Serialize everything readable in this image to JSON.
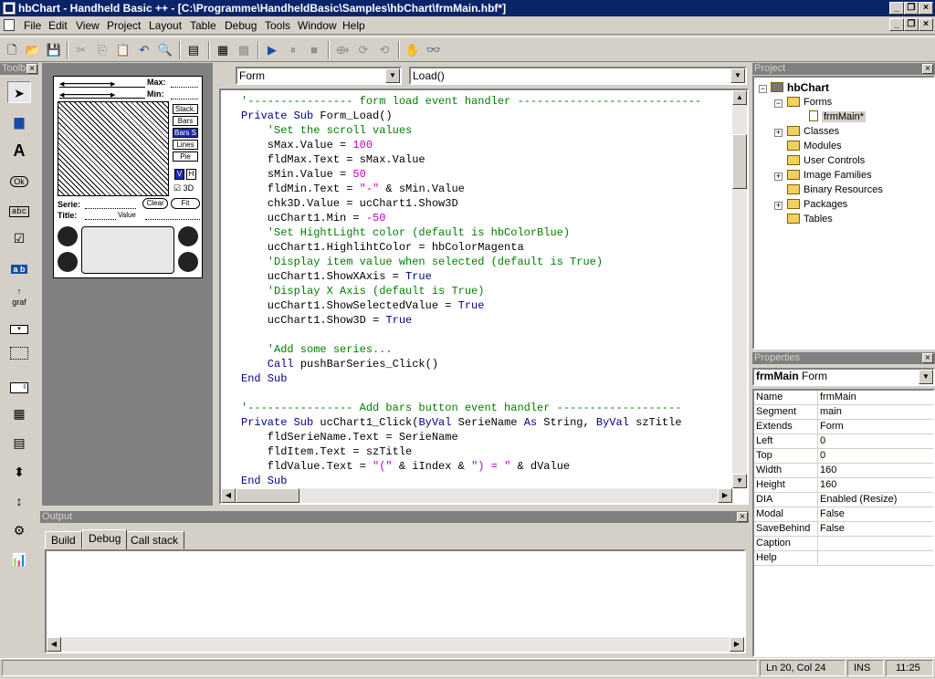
{
  "window": {
    "title": "hbChart - Handheld Basic ++ - [C:\\Programme\\HandheldBasic\\Samples\\hbChart\\frmMain.hbf*]"
  },
  "menu": [
    "File",
    "Edit",
    "View",
    "Project",
    "Layout",
    "Table",
    "Debug",
    "Tools",
    "Window",
    "Help"
  ],
  "toolbox": {
    "title": "Toolb"
  },
  "toolbox_items": [
    "pointer-tool",
    "image-tool",
    "label-tool",
    "button-tool",
    "field-tool",
    "checkbox-tool",
    "pushbutton-tool",
    "graffiti-tool",
    "popup-tool",
    "selector-tool",
    "scroll-tool",
    "table-tool",
    "list-tool",
    "slider-tool",
    "repeat-tool",
    "gadget-tool",
    "chart-tool"
  ],
  "toolbox_labels": {
    "ok": "Ok",
    "abc": "abc",
    "ab": "a b",
    "graf": "graf"
  },
  "form": {
    "max_label": "Max:",
    "min_label": "Min:",
    "stack": "Stack.",
    "bars": "Bars",
    "bars_s": "Bars S",
    "lines": "Lines",
    "pie": "Pie",
    "v": "V",
    "h": "H",
    "threed": "3D",
    "serie_label": "Serie:",
    "title_label": "Title:",
    "value_label": "Value",
    "clear": "Clear",
    "fit": "Fit"
  },
  "editor": {
    "object_combo": "Form",
    "proc_combo": "Load()",
    "lines": [
      [
        {
          "c": "cm",
          "t": "'---------------- form load event handler ----------------------------"
        }
      ],
      [
        {
          "c": "kw",
          "t": "Private Sub "
        },
        {
          "c": "",
          "t": "Form_Load()"
        }
      ],
      [
        {
          "c": "cm",
          "t": "    'Set the scroll values"
        }
      ],
      [
        {
          "c": "",
          "t": "    sMax.Value = "
        },
        {
          "c": "nm",
          "t": "100"
        }
      ],
      [
        {
          "c": "",
          "t": "    fldMax.Text = sMax.Value"
        }
      ],
      [
        {
          "c": "",
          "t": "    sMin.Value = "
        },
        {
          "c": "nm",
          "t": "50"
        }
      ],
      [
        {
          "c": "",
          "t": "    fldMin.Text = "
        },
        {
          "c": "st",
          "t": "\"-\""
        },
        {
          "c": "",
          "t": " & sMin.Value"
        }
      ],
      [
        {
          "c": "",
          "t": "    chk3D.Value = ucChart1.Show3D"
        }
      ],
      [
        {
          "c": "",
          "t": "    ucChart1.Min = "
        },
        {
          "c": "nm",
          "t": "-50"
        }
      ],
      [
        {
          "c": "cm",
          "t": "    'Set HightLight color (default is hbColorBlue)"
        }
      ],
      [
        {
          "c": "",
          "t": "    ucChart1.HighlihtColor = hbColorMagenta"
        }
      ],
      [
        {
          "c": "cm",
          "t": "    'Display item value when selected (default is True)"
        }
      ],
      [
        {
          "c": "",
          "t": "    ucChart1.ShowXAxis = "
        },
        {
          "c": "kw",
          "t": "True"
        }
      ],
      [
        {
          "c": "cm",
          "t": "    'Display X Axis (default is True)"
        }
      ],
      [
        {
          "c": "",
          "t": "    ucChart1.ShowSelectedValue = "
        },
        {
          "c": "kw",
          "t": "True"
        }
      ],
      [
        {
          "c": "",
          "t": "    ucChart1.Show3D = "
        },
        {
          "c": "kw",
          "t": "True"
        }
      ],
      [
        {
          "c": "",
          "t": ""
        }
      ],
      [
        {
          "c": "cm",
          "t": "    'Add some series..."
        }
      ],
      [
        {
          "c": "kw",
          "t": "    Call "
        },
        {
          "c": "",
          "t": "pushBarSeries_Click()"
        }
      ],
      [
        {
          "c": "kw",
          "t": "End Sub"
        }
      ],
      [
        {
          "c": "",
          "t": ""
        }
      ],
      [
        {
          "c": "cm",
          "t": "'---------------- Add bars button event handler -------------------"
        }
      ],
      [
        {
          "c": "kw",
          "t": "Private Sub "
        },
        {
          "c": "",
          "t": "ucChart1_Click("
        },
        {
          "c": "kw",
          "t": "ByVal "
        },
        {
          "c": "",
          "t": "SerieName "
        },
        {
          "c": "kw",
          "t": "As "
        },
        {
          "c": "",
          "t": "String, "
        },
        {
          "c": "kw",
          "t": "ByVal "
        },
        {
          "c": "",
          "t": "szTitle"
        }
      ],
      [
        {
          "c": "",
          "t": "    fldSerieName.Text = SerieName"
        }
      ],
      [
        {
          "c": "",
          "t": "    fldItem.Text = szTitle"
        }
      ],
      [
        {
          "c": "",
          "t": "    fldValue.Text = "
        },
        {
          "c": "st",
          "t": "\"(\""
        },
        {
          "c": "",
          "t": " & iIndex & "
        },
        {
          "c": "st",
          "t": "\") = \""
        },
        {
          "c": "",
          "t": " & dValue"
        }
      ],
      [
        {
          "c": "kw",
          "t": "End Sub"
        }
      ]
    ]
  },
  "project": {
    "title": "Project",
    "root": "hbChart",
    "items": [
      "Forms",
      "frmMain*",
      "Classes",
      "Modules",
      "User Controls",
      "Image Families",
      "Binary Resources",
      "Packages",
      "Tables"
    ]
  },
  "properties": {
    "title": "Properties",
    "object_name": "frmMain",
    "object_type": "Form",
    "rows": [
      {
        "k": "Name",
        "v": "frmMain"
      },
      {
        "k": "Segment",
        "v": "main"
      },
      {
        "k": "Extends",
        "v": "Form"
      },
      {
        "k": "Left",
        "v": "0"
      },
      {
        "k": "Top",
        "v": "0"
      },
      {
        "k": "Width",
        "v": "160"
      },
      {
        "k": "Height",
        "v": "160"
      },
      {
        "k": "DIA",
        "v": "Enabled (Resize)"
      },
      {
        "k": "Modal",
        "v": "False"
      },
      {
        "k": "SaveBehind",
        "v": "False"
      },
      {
        "k": "Caption",
        "v": ""
      },
      {
        "k": "Help",
        "v": ""
      }
    ]
  },
  "output": {
    "title": "Output",
    "tabs": [
      "Build",
      "Debug",
      "Call stack"
    ]
  },
  "status": {
    "pos": "Ln 20, Col 24",
    "mode": "INS",
    "time": "11:25"
  }
}
